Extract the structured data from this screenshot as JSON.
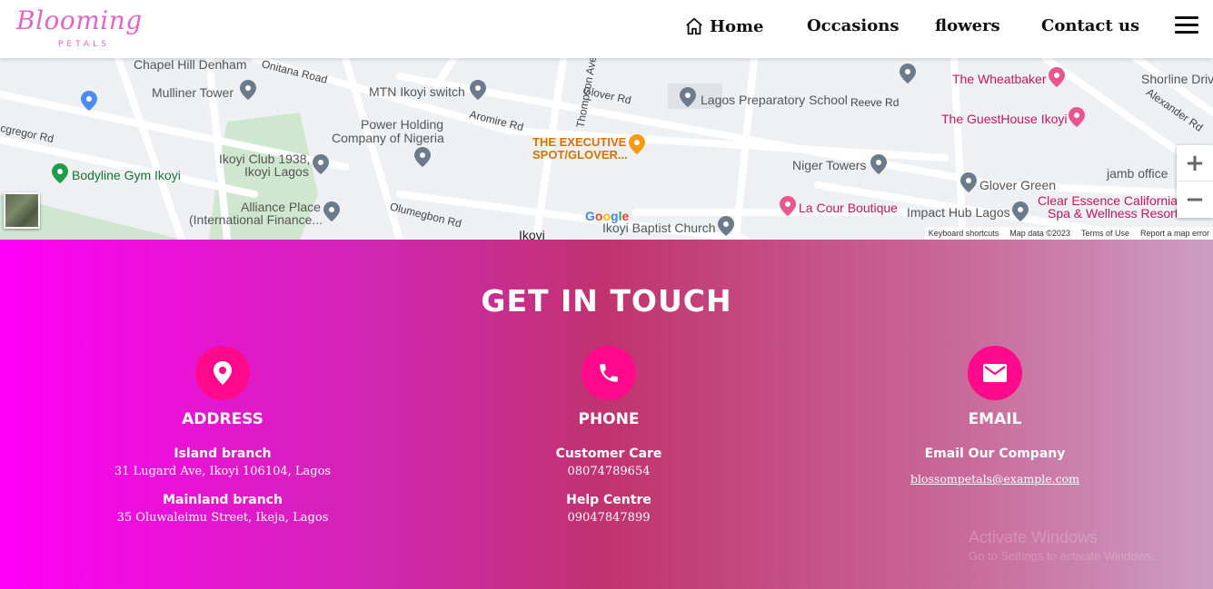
{
  "header": {
    "logo": {
      "text": "Blooming",
      "sub": "PETALS"
    },
    "nav": [
      {
        "label": "Home",
        "icon": "home-icon"
      },
      {
        "label": "Occasions"
      },
      {
        "label": "flowers"
      },
      {
        "label": "Contact us"
      }
    ],
    "menu_icon": "hamburger-menu-icon"
  },
  "map": {
    "places": [
      {
        "label": "Chapel Hill Denham",
        "type": "place"
      },
      {
        "label": "Mulliner Tower",
        "type": "place"
      },
      {
        "label": "MTN Ikoyi switch",
        "type": "place"
      },
      {
        "label": "Power Holding Company of Nigeria",
        "line1": "Power Holding",
        "line2": "Company of Nigeria",
        "type": "place"
      },
      {
        "label": "Lagos Preparatory School",
        "type": "place"
      },
      {
        "label": "The Wheatbaker",
        "type": "hotel"
      },
      {
        "label": "The GuestHouse Ikoyi",
        "type": "hotel"
      },
      {
        "label": "Shorline Driv",
        "type": "road"
      },
      {
        "label": "Alexander Rd",
        "type": "road"
      },
      {
        "label": "Ikoyi Club 1938, Ikoyi Lagos",
        "line1": "Ikoyi Club 1938,",
        "line2": "Ikoyi Lagos",
        "type": "place"
      },
      {
        "label": "Bodyline Gym Ikoyi",
        "type": "gym"
      },
      {
        "label": "THE EXECUTIVE SPOT/GLOVER...",
        "line1": "THE EXECUTIVE",
        "line2": "SPOT/GLOVER...",
        "type": "restaurant"
      },
      {
        "label": "Niger Towers",
        "type": "place"
      },
      {
        "label": "Glover Green",
        "type": "place"
      },
      {
        "label": "jamb office",
        "type": "place"
      },
      {
        "label": "Alliance Place (International Finance...",
        "line1": "Alliance Place",
        "line2": "(International Finance...",
        "type": "place"
      },
      {
        "label": "La Cour Boutique",
        "type": "hotel"
      },
      {
        "label": "Impact Hub Lagos",
        "type": "place"
      },
      {
        "label": "Clear Essence California Spa & Wellness Resort",
        "line1": "Clear Essence California",
        "line2": "Spa & Wellness Resort",
        "type": "hotel"
      },
      {
        "label": "Ikoyi Baptist Church",
        "type": "church"
      },
      {
        "label": "Ikoyi",
        "type": "area"
      }
    ],
    "roads": [
      "Onitana Road",
      "Glover Rd",
      "Reeve Rd",
      "Aromire Rd",
      "Thompson Ave",
      "cgregor Rd",
      "Olumegbon Rd"
    ],
    "google_logo": "Google",
    "footer": [
      "Keyboard shortcuts",
      "Map data ©2023",
      "Terms of Use",
      "Report a map error"
    ],
    "zoom_in": "+",
    "zoom_out": "−"
  },
  "contact": {
    "title": "GET IN TOUCH",
    "accent_color": "#ff0a8c",
    "columns": [
      {
        "icon": "location-pin-icon",
        "heading": "ADDRESS",
        "items": [
          {
            "sub": "Island branch",
            "text": "31 Lugard Ave, Ikoyi 106104, Lagos"
          },
          {
            "sub": "Mainland branch",
            "text": "35 Oluwaleimu Street, Ikeja, Lagos"
          }
        ]
      },
      {
        "icon": "phone-icon",
        "heading": "PHONE",
        "items": [
          {
            "sub": "Customer Care",
            "text": "08074789654"
          },
          {
            "sub": "Help Centre",
            "text": "09047847899"
          }
        ]
      },
      {
        "icon": "envelope-icon",
        "heading": "EMAIL",
        "items": [
          {
            "sub": "Email Our Company",
            "link": "blossompetals@example.com"
          }
        ]
      }
    ],
    "watermark": {
      "line1": "Activate Windows",
      "line2": "Go to Settings to activate Windows."
    }
  }
}
